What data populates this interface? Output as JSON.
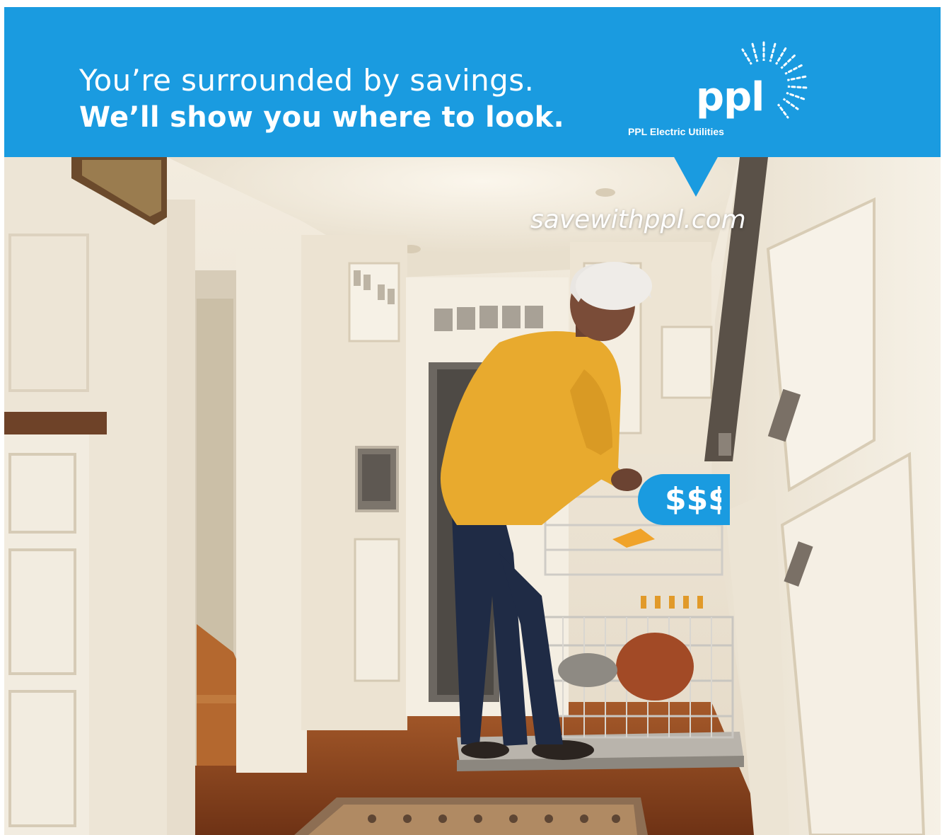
{
  "ad": {
    "headline_line1": "You’re surrounded by savings.",
    "headline_line2": "We’ll show you where to look.",
    "url": "savewithppl.com",
    "bubble_text": "$$$"
  },
  "logo": {
    "wordmark": "ppl",
    "subtitle": "PPL Electric Utilities"
  },
  "colors": {
    "brand_blue": "#1a9be0",
    "sweater": "#e8aa2e",
    "cabinet": "#efe8da",
    "floor": "#8a4420"
  }
}
